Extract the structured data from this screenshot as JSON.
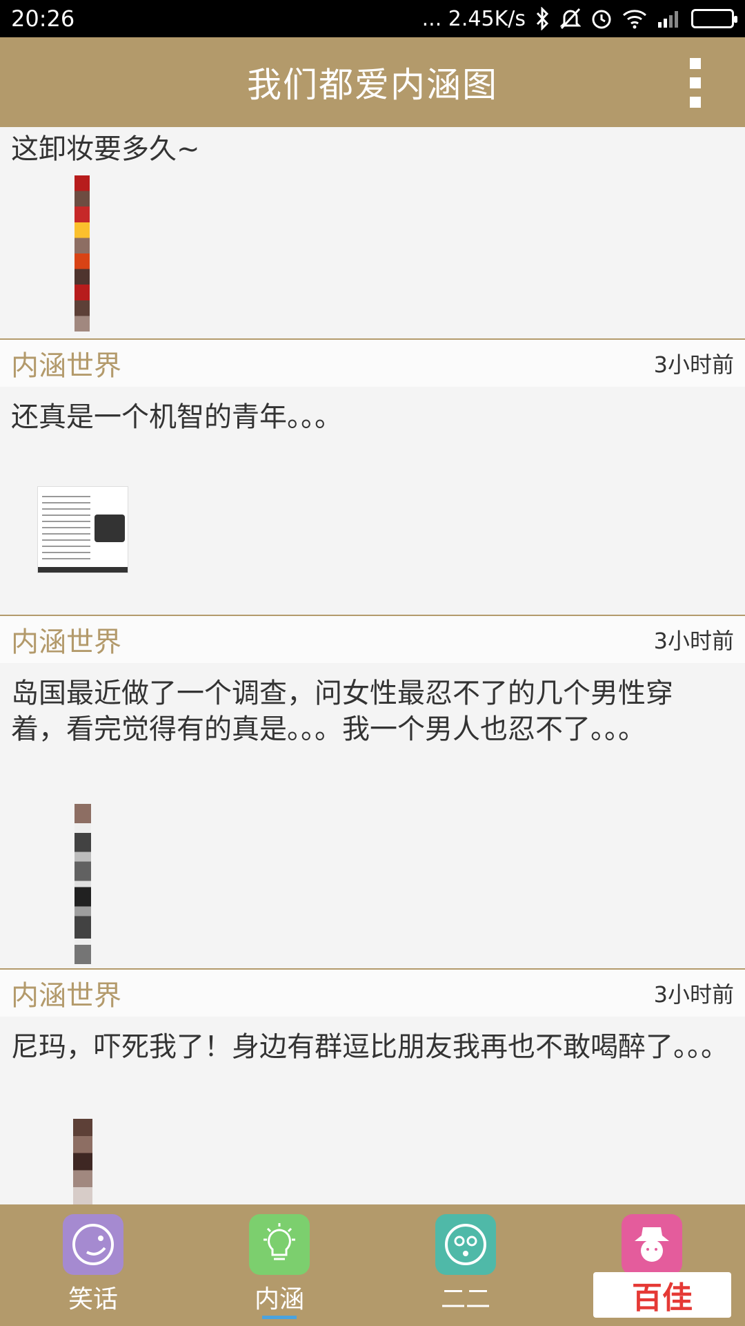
{
  "status_bar": {
    "time": "20:26",
    "network_speed": "... 2.45K/s",
    "icons": [
      "bluetooth-icon",
      "mute-icon",
      "alarm-icon",
      "wifi-icon",
      "signal-icon",
      "battery-icon"
    ]
  },
  "app_bar": {
    "title": "我们都爱内涵图",
    "menu_icon": "overflow-menu-icon"
  },
  "feed": {
    "items": [
      {
        "text": "这卸妆要多久~",
        "author": "",
        "time": ""
      },
      {
        "author": "内涵世界",
        "time": "3小时前",
        "text": "还真是一个机智的青年。。。"
      },
      {
        "author": "内涵世界",
        "time": "3小时前",
        "text": "岛国最近做了一个调查，问女性最忍不了的几个男性穿着，看完觉得有的真是。。。我一个男人也忍不了。。。"
      },
      {
        "author": "内涵世界",
        "time": "3小时前",
        "text": "尼玛，吓死我了！身边有群逗比朋友我再也不敢喝醉了。。。"
      }
    ]
  },
  "bottom_nav": {
    "tabs": [
      {
        "label": "笑话",
        "icon": "joke-face-icon",
        "color": "#a58ad0"
      },
      {
        "label": "内涵",
        "icon": "lightbulb-icon",
        "color": "#7ccf6e",
        "active": true
      },
      {
        "label": "二二",
        "icon": "silly-face-icon",
        "color": "#4fb9a8"
      },
      {
        "label": "",
        "icon": "hat-face-icon",
        "color": "#e45c9c"
      }
    ]
  },
  "watermark": {
    "text": "百佳"
  },
  "colors": {
    "accent": "#b39a6b",
    "active_underline": "#4aa3df",
    "battery": "#4cd137"
  }
}
